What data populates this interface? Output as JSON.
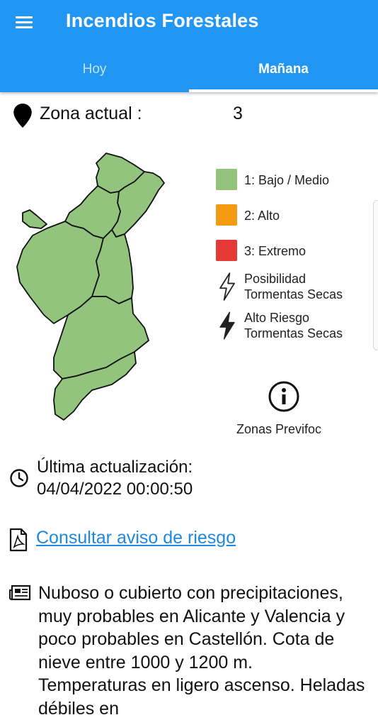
{
  "appbar": {
    "title": "Incendios Forestales",
    "menu_icon": "hamburger-menu-icon",
    "background": "#2196f3"
  },
  "tabs": [
    {
      "label": "Hoy",
      "active": false
    },
    {
      "label": "Mañana",
      "active": true
    }
  ],
  "zone": {
    "label": "Zona actual :",
    "value": "3",
    "icon": "location-pin-icon"
  },
  "map": {
    "fill_color": "#93c47d",
    "zones": [
      1,
      2,
      3,
      4,
      5,
      6,
      7
    ]
  },
  "legend": {
    "items": [
      {
        "label": "1: Bajo / Medio",
        "color": "#93c47d"
      },
      {
        "label": "2: Alto",
        "color": "#f39c12"
      },
      {
        "label": "3: Extremo",
        "color": "#e53935"
      }
    ],
    "storm_possible": {
      "line1": "Posibilidad",
      "line2": "Tormentas Secas",
      "icon": "lightning-outline-icon"
    },
    "storm_high": {
      "line1": "Alto Riesgo",
      "line2": "Tormentas Secas",
      "icon": "lightning-filled-icon"
    }
  },
  "info": {
    "label": "Zonas Previfoc",
    "icon": "info-circle-icon"
  },
  "update": {
    "title": "Última actualización:",
    "datetime": "04/04/2022 00:00:50",
    "icon": "clock-icon"
  },
  "risk_link": {
    "label": "Consultar aviso de riesgo",
    "icon": "pdf-file-icon",
    "color": "#1e88e5"
  },
  "forecast": {
    "icon": "newspaper-icon",
    "text": "Nuboso o cubierto con precipitaciones, muy probables en Alicante y Valencia y poco probables en Castellón. Cota de nieve entre 1000 y 1200 m. Temperaturas en ligero ascenso. Heladas débiles en"
  }
}
